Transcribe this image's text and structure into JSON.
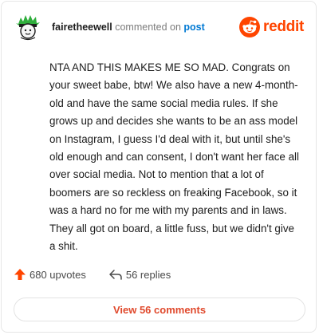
{
  "comment": {
    "author": "fairetheewell",
    "action_text": "commented on",
    "post_link_label": "post",
    "body": "NTA AND THIS MAKES ME SO MAD. Congrats on your sweet babe, btw! We also have a new 4-month-old and have the same social media rules. If she grows up and decides she wants to be an ass model on Instagram, I guess I'd deal with it, but until she's old enough and can consent, I don't want her face all over social media. Not to mention that a lot of boomers are so reckless on freaking Facebook, so it was a hard no for me with my parents and in laws. They all got on board, a little fuss, but we didn't give a shit."
  },
  "brand": {
    "wordmark": "reddit",
    "color": "#ff4500"
  },
  "stats": {
    "upvotes_label": "680 upvotes",
    "upvote_icon": "upvote-arrow-icon",
    "upvote_icon_color": "#ff4500",
    "replies_label": "56 replies",
    "reply_icon": "reply-arrow-icon"
  },
  "footer": {
    "view_comments_label": "View 56 comments"
  },
  "colors": {
    "text": "#1c1c1c",
    "muted": "#7c7c7c",
    "link": "#0079d3",
    "button_text": "#e0492c"
  }
}
